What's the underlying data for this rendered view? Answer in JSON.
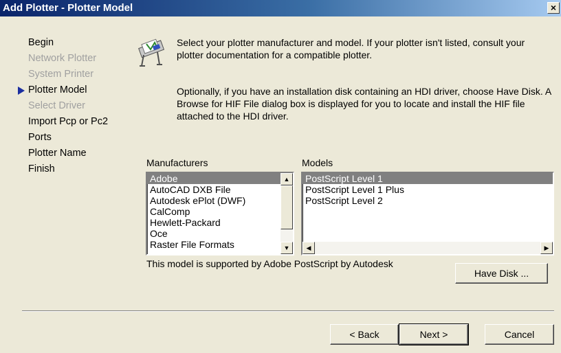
{
  "window": {
    "title": "Add Plotter - Plotter Model",
    "close_glyph": "×"
  },
  "steps": [
    {
      "label": "Begin",
      "state": "normal"
    },
    {
      "label": "Network Plotter",
      "state": "disabled"
    },
    {
      "label": "System Printer",
      "state": "disabled"
    },
    {
      "label": "Plotter Model",
      "state": "current"
    },
    {
      "label": "Select Driver",
      "state": "disabled"
    },
    {
      "label": "Import Pcp or Pc2",
      "state": "normal"
    },
    {
      "label": "Ports",
      "state": "normal"
    },
    {
      "label": "Plotter Name",
      "state": "normal"
    },
    {
      "label": "Finish",
      "state": "normal"
    }
  ],
  "instructions": {
    "paragraph1": "Select your plotter manufacturer and model. If your plotter isn't listed, consult your plotter documentation for a compatible plotter.",
    "paragraph2": "Optionally, if you have an installation disk containing an HDI driver, choose Have Disk. A Browse for HIF File dialog box is displayed for you to locate and install the HIF file attached to the HDI driver."
  },
  "manufacturers": {
    "label": "Manufacturers",
    "items": [
      "Adobe",
      "AutoCAD DXB File",
      "Autodesk ePlot (DWF)",
      "CalComp",
      "Hewlett-Packard",
      "Oce",
      "Raster File Formats"
    ],
    "selected": "Adobe"
  },
  "models": {
    "label": "Models",
    "items": [
      "PostScript Level 1",
      "PostScript Level 1 Plus",
      "PostScript Level 2"
    ],
    "selected": "PostScript Level 1"
  },
  "status_text": "This model is supported by Adobe PostScript by Autodesk",
  "buttons": {
    "have_disk": "Have Disk ...",
    "back": "< Back",
    "next": "Next >",
    "cancel": "Cancel"
  },
  "colors": {
    "title_bar": "#0a246a",
    "selection": "#808080",
    "current_step_arrow": "#1c2fa0"
  },
  "icons": {
    "scroll_up": "▲",
    "scroll_down": "▼",
    "scroll_left": "◀",
    "scroll_right": "▶"
  }
}
